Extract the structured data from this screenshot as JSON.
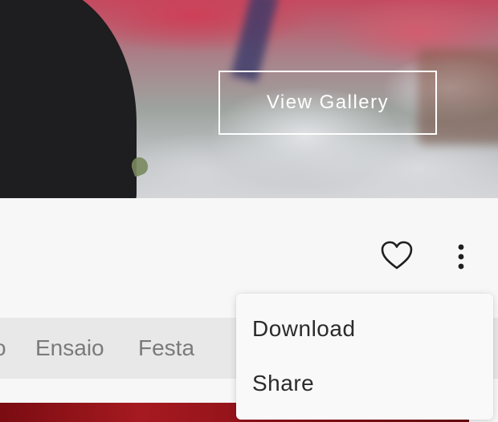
{
  "hero": {
    "button_label": "View Gallery"
  },
  "actions": {
    "favorite_icon": "heart-outline-icon",
    "more_icon": "vertical-ellipsis-icon"
  },
  "categories": {
    "items": [
      "o",
      "Ensaio",
      "Festa"
    ]
  },
  "dropdown": {
    "items": [
      "Download",
      "Share"
    ]
  },
  "colors": {
    "page_bg": "#f7f7f7",
    "category_bar_bg": "#e8e8e8",
    "menu_bg": "#f9f9f9",
    "text_dark": "#2b2b2b",
    "text_muted": "#7a7a7a"
  }
}
